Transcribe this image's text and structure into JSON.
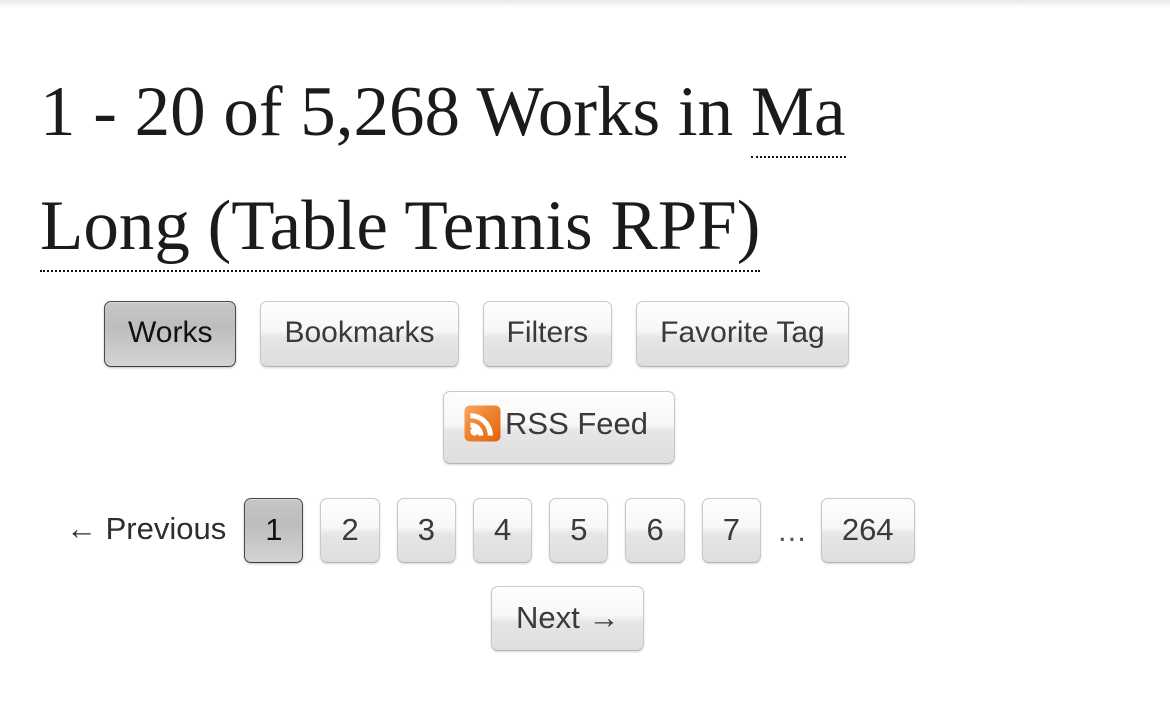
{
  "heading": {
    "prefix": "1 - 20 of 5,268 Works in ",
    "tag": "Ma Long (Table Tennis RPF)"
  },
  "nav": {
    "items": [
      {
        "label": "Works",
        "selected": true
      },
      {
        "label": "Bookmarks",
        "selected": false
      },
      {
        "label": "Filters",
        "selected": false
      },
      {
        "label": "Favorite Tag",
        "selected": false
      }
    ]
  },
  "rss": {
    "label": "RSS Feed",
    "icon": "rss-icon",
    "color": "#ee7219"
  },
  "pagination": {
    "previous_label": "← Previous",
    "previous_enabled": false,
    "pages": [
      {
        "label": "1",
        "current": true
      },
      {
        "label": "2",
        "current": false
      },
      {
        "label": "3",
        "current": false
      },
      {
        "label": "4",
        "current": false
      },
      {
        "label": "5",
        "current": false
      },
      {
        "label": "6",
        "current": false
      },
      {
        "label": "7",
        "current": false
      }
    ],
    "gap": "...",
    "last_page": "264",
    "next_label": "Next →"
  }
}
